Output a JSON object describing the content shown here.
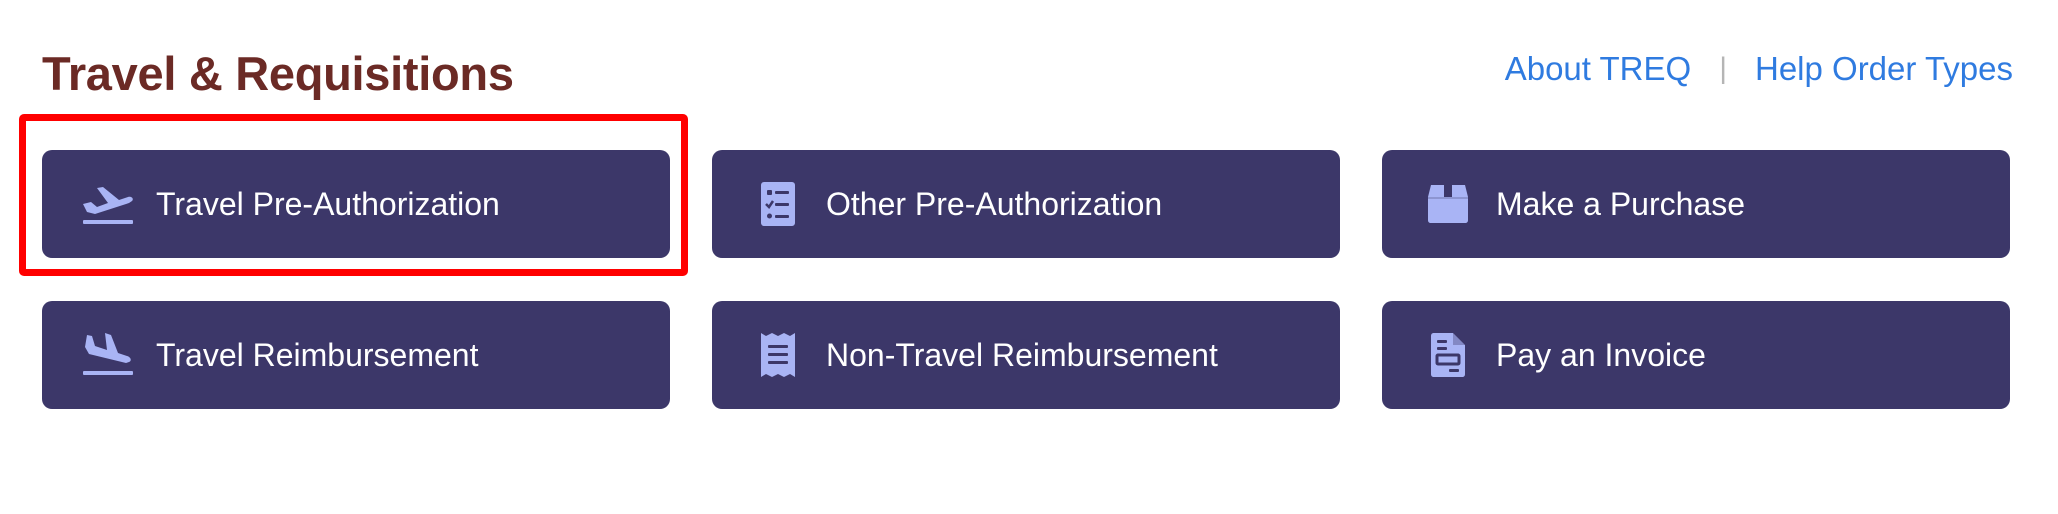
{
  "header": {
    "title": "Travel & Requisitions",
    "links": [
      {
        "label": "About TREQ"
      },
      {
        "label": "Help Order Types"
      }
    ],
    "separator": "|"
  },
  "tiles": [
    {
      "label": "Travel Pre-Authorization",
      "icon": "plane-departure-icon"
    },
    {
      "label": "Other Pre-Authorization",
      "icon": "checklist-icon"
    },
    {
      "label": "Make a Purchase",
      "icon": "box-icon"
    },
    {
      "label": "Travel Reimbursement",
      "icon": "plane-arrival-icon"
    },
    {
      "label": "Non-Travel Reimbursement",
      "icon": "receipt-icon"
    },
    {
      "label": "Pay an Invoice",
      "icon": "invoice-icon"
    }
  ],
  "colors": {
    "title": "#6b2a25",
    "link": "#2f7be0",
    "tile_bg": "#3c3769",
    "icon": "#a9b4f5",
    "highlight": "#ff0000"
  },
  "highlighted_tile": "Travel Pre-Authorization"
}
